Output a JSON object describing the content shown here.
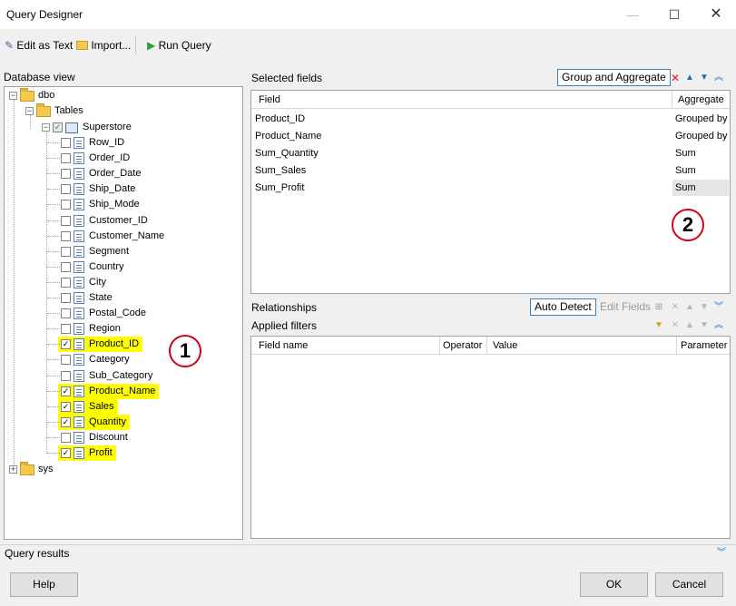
{
  "window": {
    "title": "Query Designer",
    "minimize": "—",
    "maximize": "☐",
    "close": "✕"
  },
  "toolbar": {
    "edit_as_text": "Edit as Text",
    "import": "Import...",
    "run_query": "Run Query"
  },
  "database_view": {
    "header": "Database view",
    "root": "dbo",
    "tables_node": "Tables",
    "table": "Superstore",
    "other_schema": "sys",
    "fields": [
      {
        "label": "Row_ID",
        "checked": false
      },
      {
        "label": "Order_ID",
        "checked": false
      },
      {
        "label": "Order_Date",
        "checked": false
      },
      {
        "label": "Ship_Date",
        "checked": false
      },
      {
        "label": "Ship_Mode",
        "checked": false
      },
      {
        "label": "Customer_ID",
        "checked": false
      },
      {
        "label": "Customer_Name",
        "checked": false
      },
      {
        "label": "Segment",
        "checked": false
      },
      {
        "label": "Country",
        "checked": false
      },
      {
        "label": "City",
        "checked": false
      },
      {
        "label": "State",
        "checked": false
      },
      {
        "label": "Postal_Code",
        "checked": false
      },
      {
        "label": "Region",
        "checked": false
      },
      {
        "label": "Product_ID",
        "checked": true
      },
      {
        "label": "Category",
        "checked": false
      },
      {
        "label": "Sub_Category",
        "checked": false
      },
      {
        "label": "Product_Name",
        "checked": true
      },
      {
        "label": "Sales",
        "checked": true
      },
      {
        "label": "Quantity",
        "checked": true
      },
      {
        "label": "Discount",
        "checked": false
      },
      {
        "label": "Profit",
        "checked": true
      }
    ]
  },
  "selected_fields": {
    "header": "Selected fields",
    "group_button": "Group and Aggregate",
    "col_field": "Field",
    "col_aggregate": "Aggregate",
    "rows": [
      {
        "field": "Product_ID",
        "aggregate": "Grouped by"
      },
      {
        "field": "Product_Name",
        "aggregate": "Grouped by"
      },
      {
        "field": "Sum_Quantity",
        "aggregate": "Sum"
      },
      {
        "field": "Sum_Sales",
        "aggregate": "Sum"
      },
      {
        "field": "Sum_Profit",
        "aggregate": "Sum"
      }
    ]
  },
  "relationships": {
    "header": "Relationships",
    "auto_detect": "Auto Detect",
    "edit_fields": "Edit Fields"
  },
  "applied_filters": {
    "header": "Applied filters",
    "col_field_name": "Field name",
    "col_operator": "Operator",
    "col_value": "Value",
    "col_parameter": "Parameter"
  },
  "annotations": {
    "one": "1",
    "two": "2"
  },
  "query_results": {
    "header": "Query results"
  },
  "footer": {
    "help": "Help",
    "ok": "OK",
    "cancel": "Cancel"
  },
  "colors": {
    "highlight": "#ffff00",
    "annotation": "#d0021b",
    "accent": "#1f6fc5"
  }
}
